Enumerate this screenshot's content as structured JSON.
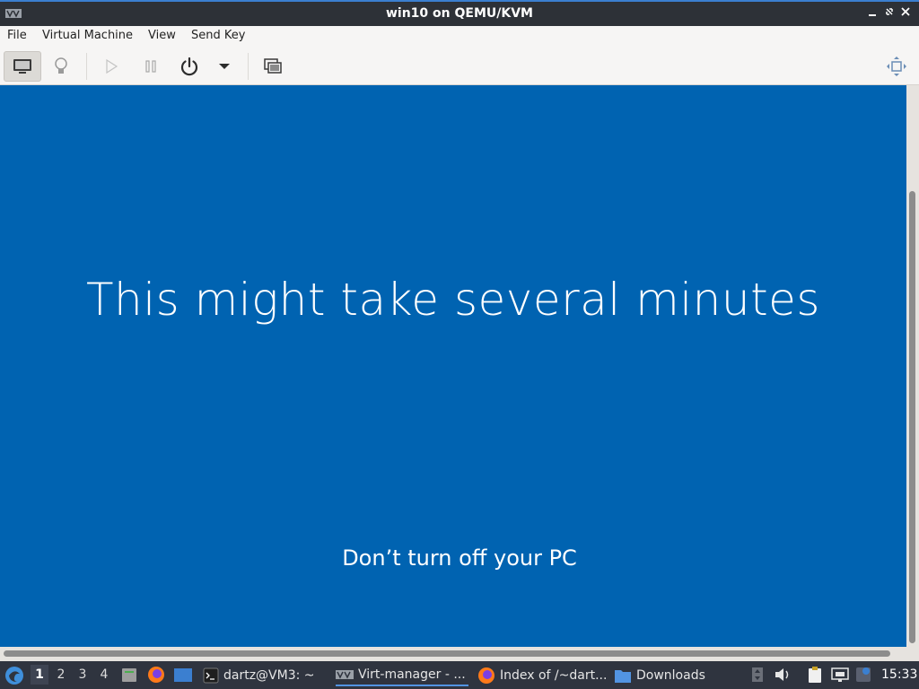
{
  "window": {
    "title": "win10 on QEMU/KVM",
    "controls": [
      "minimize",
      "maximize",
      "close"
    ]
  },
  "menubar": {
    "items": [
      {
        "label": "File"
      },
      {
        "label": "Virtual Machine"
      },
      {
        "label": "View"
      },
      {
        "label": "Send Key"
      }
    ]
  },
  "toolbar": {
    "buttons": [
      {
        "icon": "console-icon",
        "active": true
      },
      {
        "icon": "details-lightbulb-icon",
        "active": false
      },
      {
        "icon": "run-play-icon",
        "enabled": false
      },
      {
        "icon": "pause-icon",
        "enabled": false
      },
      {
        "icon": "power-icon",
        "enabled": true
      },
      {
        "icon": "chevron-down-icon",
        "enabled": true
      },
      {
        "icon": "snapshots-icon",
        "enabled": true
      },
      {
        "icon": "fullscreen-icon",
        "enabled": true
      }
    ]
  },
  "vm_screen": {
    "message": "This might take several minutes",
    "submessage": "Don’t turn off your PC",
    "background_color": "#0063b1"
  },
  "taskbar": {
    "workspaces": [
      "1",
      "2",
      "3",
      "4"
    ],
    "active_workspace": "1",
    "tasks": [
      {
        "label": "dartz@VM3: ~",
        "icon": "terminal-icon"
      },
      {
        "label": "Virt-manager - ...",
        "icon": "virt-manager-icon",
        "active": true
      },
      {
        "label": "Index of /~dart...",
        "icon": "firefox-icon"
      },
      {
        "label": "Downloads",
        "icon": "folder-icon"
      }
    ],
    "clock": "15:33"
  },
  "colors": {
    "accent": "#5294e2",
    "titlebar": "#2d3137",
    "taskbar": "#2f343f"
  }
}
